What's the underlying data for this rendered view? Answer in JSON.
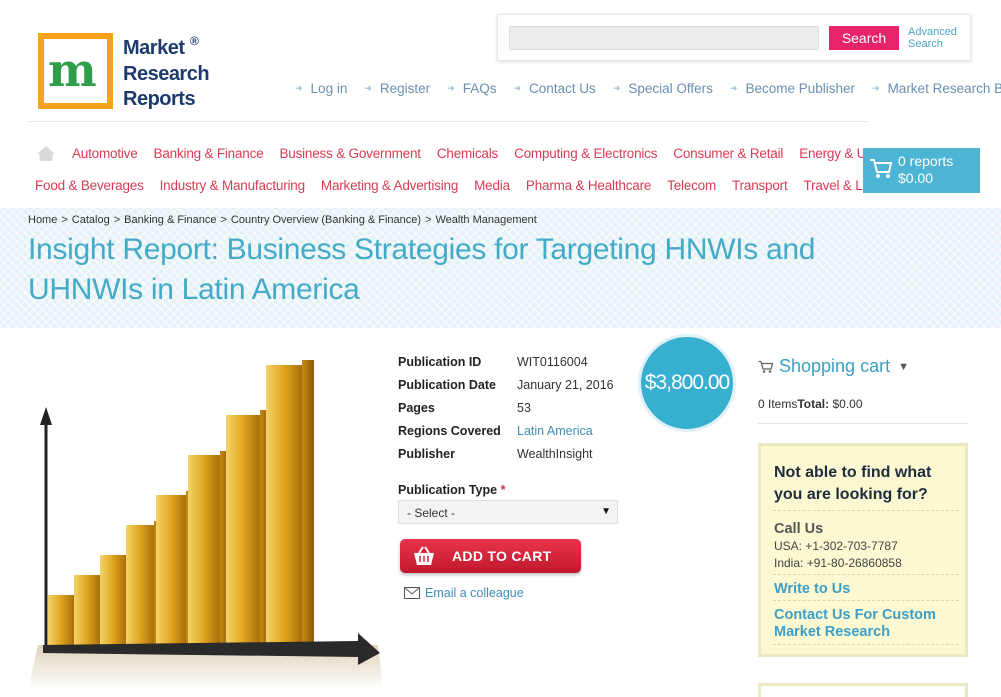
{
  "logo": {
    "line1": "Market",
    "line2": "Research",
    "line3": "Reports",
    "registered": "®",
    "mark_letter": "m"
  },
  "search": {
    "placeholder": "",
    "button_label": "Search",
    "advanced_label": "Advanced Search"
  },
  "top_links": [
    "Log in",
    "Register",
    "FAQs",
    "Contact Us",
    "Special Offers",
    "Become Publisher",
    "Market Research Blog"
  ],
  "categories_row1": [
    "Automotive",
    "Banking & Finance",
    "Business & Government",
    "Chemicals",
    "Computing & Electronics",
    "Consumer & Retail",
    "Energy & Utilities"
  ],
  "categories_row2": [
    "Food & Beverages",
    "Industry & Manufacturing",
    "Marketing & Advertising",
    "Media",
    "Pharma & Healthcare",
    "Telecom",
    "Transport",
    "Travel & Leisure"
  ],
  "cart": {
    "count_label": "0 reports",
    "total_label": "$0.00"
  },
  "breadcrumb": [
    "Home",
    "Catalog",
    "Banking & Finance",
    "Country Overview (Banking & Finance)",
    "Wealth Management"
  ],
  "title": "Insight Report: Business Strategies for Targeting HNWIs and UHNWIs in Latin America",
  "details": [
    {
      "label": "Publication ID",
      "value": "WIT0116004",
      "link": false
    },
    {
      "label": "Publication Date",
      "value": "January 21, 2016",
      "link": false
    },
    {
      "label": "Pages",
      "value": "53",
      "link": false
    },
    {
      "label": "Regions Covered",
      "value": "Latin America",
      "link": true
    },
    {
      "label": "Publisher",
      "value": "WealthInsight",
      "link": false
    }
  ],
  "price": "$3,800.00",
  "publication_type": {
    "label": "Publication Type",
    "required_mark": "*",
    "selected": "- Select -"
  },
  "add_to_cart_label": "ADD TO CART",
  "email_colleague_label": "Email a colleague",
  "shopping_cart": {
    "title": "Shopping cart",
    "items_label": "0 Items",
    "total_label": "Total:",
    "total_value": " $0.00"
  },
  "help": {
    "title": "Not able to find what you are looking for?",
    "call_us": "Call Us",
    "usa": "USA: +1-302-703-7787",
    "india": "India: +91-80-26860858",
    "write": "Write to Us",
    "custom": "Contact Us For Custom Market Research"
  },
  "colors": {
    "accent": "#43aac8",
    "category_red": "#d73c55",
    "search_pink": "#e8236b",
    "cart_blue": "#4db4d4",
    "cta_red": "#d4233b",
    "logo_orange": "#f6a31b"
  },
  "icons": [
    "home-icon",
    "cart-icon",
    "basket-icon",
    "envelope-icon",
    "caret-down-icon",
    "arrow-right-icon"
  ]
}
